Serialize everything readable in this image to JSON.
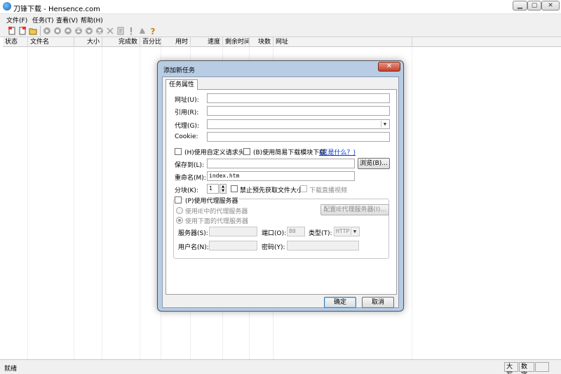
{
  "window": {
    "title": "刀锋下载 - Hensence.com"
  },
  "menu": [
    "文件(F)",
    "任务(T)",
    "查看(V)",
    "帮助(H)"
  ],
  "columns": [
    "状态",
    "文件名",
    "大小",
    "完成数",
    "百分比",
    "用时",
    "速度",
    "剩余时间",
    "块数",
    "网址"
  ],
  "status": {
    "text": "就绪",
    "caps": "大写",
    "num": "数字"
  },
  "dialog": {
    "title": "添加新任务",
    "close": "✕",
    "tab": "任务属性",
    "url_label": "网址(U):",
    "referer_label": "引用(R):",
    "proxy_label": "代理(G):",
    "cookie_label": "Cookie:",
    "custom_header": "(H)使用自定义请求头",
    "use_hensence": "(B)使用简易下载模块下载",
    "what_is": "(这是什么？)",
    "save_to_label": "保存到(L):",
    "browse": "浏览(B)...",
    "rename_label": "重命名(M):",
    "rename_value": "index.htm",
    "blocks_label": "分块(K):",
    "blocks_value": "1",
    "no_probe": "禁止预先获取文件大小",
    "stream": "下载直播视频",
    "use_proxy": "(P)使用代理服务器",
    "use_ie_proxy": "使用IE中的代理服务器",
    "use_below_proxy": "使用下面的代理服务器",
    "config_ie": "配置IE代理服务器(I)...",
    "server_label": "服务器(S):",
    "port_label": "端口(O):",
    "port_value": "80",
    "type_label": "类型(T):",
    "type_value": "HTTP",
    "user_label": "用户名(N):",
    "password_label": "密码(Y):",
    "ok": "确定",
    "cancel": "取消"
  }
}
